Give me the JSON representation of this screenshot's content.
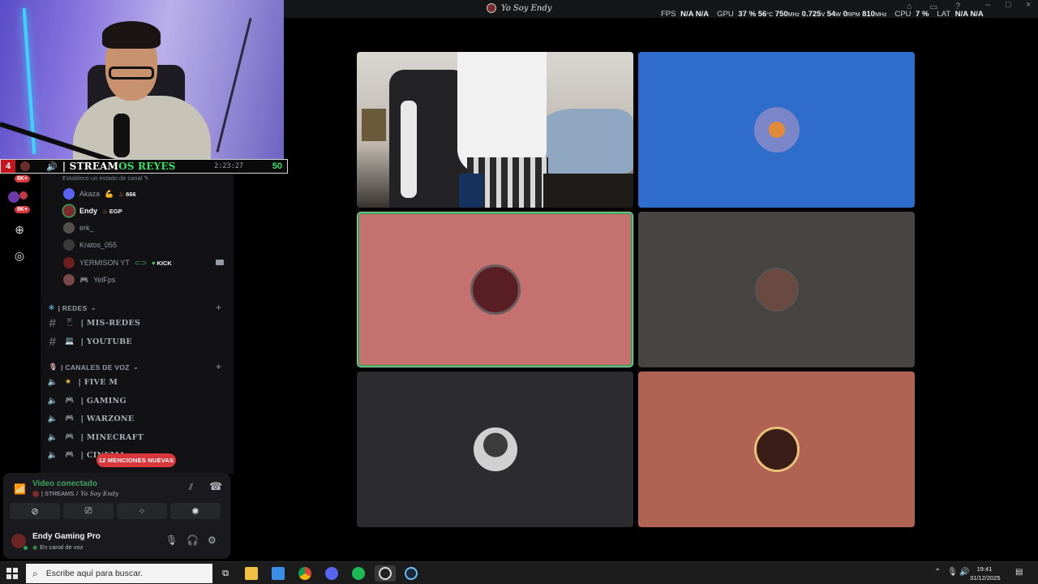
{
  "window": {
    "title": "Yo Soy Endy"
  },
  "perf": {
    "fps_label": "FPS",
    "fps_values": [
      "N/A",
      "N/A"
    ],
    "gpu_label": "GPU",
    "gpu_usage": "37 %",
    "gpu_temp": "56",
    "gpu_temp_unit": "°C",
    "gpu_clock": "750",
    "gpu_clock_unit": "MHz",
    "gpu_voltage": "0.725",
    "gpu_voltage_unit": "V",
    "gpu_power": "54",
    "gpu_power_unit": "W",
    "fan": "0",
    "fan_unit": "RPM",
    "mem_clock": "810",
    "mem_clock_unit": "MHz",
    "cpu_label": "CPU",
    "cpu_usage": "7 %",
    "lat_label": "LAT",
    "lat_values": [
      "N/A",
      "N/A"
    ]
  },
  "banner": {
    "count_left": "4",
    "title_prefix": "| STREAM",
    "title_suffix": "OS REYES",
    "time": "2:23:27",
    "count_right": "50"
  },
  "rail": {
    "badge_1": "8K+",
    "badge_2": "9K+",
    "add_icon": "plus-icon",
    "discover_icon": "compass-icon"
  },
  "channels": {
    "status_hint": "Establece un estado de canal",
    "members": [
      {
        "name": "Akaza",
        "emoji": "💪",
        "tag": "666",
        "tag_icon": "fire-icon",
        "color": "#5865f2"
      },
      {
        "name": "Endy",
        "tag": "EGP",
        "tag_icon": "fire-icon",
        "color": "#7a2b2b"
      },
      {
        "name": "erk_",
        "color": "#55504c"
      },
      {
        "name": "Kratos_055",
        "color": "#3a3a3a"
      },
      {
        "name": "YERMISON YT",
        "tag": "KICK",
        "tag_icon": "heart-icon",
        "color": "#6e1f1f"
      },
      {
        "name": "YelFps",
        "prefix": "🎮",
        "color": "#7a4a4a"
      }
    ],
    "categories": [
      {
        "label": "| REDES",
        "icon": "snowflake-icon"
      },
      {
        "label": "| CANALES DE VOZ",
        "icon": "mic-icon"
      }
    ],
    "text_channels": [
      {
        "label": "| MIS-REDES",
        "emoji": "📱"
      },
      {
        "label": "| YOUTUBE",
        "emoji": "💻"
      }
    ],
    "voice_channels": [
      {
        "label": "| FIVE M",
        "emoji": "★"
      },
      {
        "label": "| GAMING",
        "emoji": "🎮"
      },
      {
        "label": "| WARZONE",
        "emoji": "🎮"
      },
      {
        "label": "| MINECRAFT",
        "emoji": "🎮"
      },
      {
        "label": "| CINEMA",
        "emoji": "🎮"
      }
    ],
    "mentions_pill": "12 MENCIONES NUEVAS"
  },
  "voice": {
    "status": "Video conectado",
    "channel": "| STREAMS",
    "server": "Yo Soy Endy",
    "buttons": [
      "camera-off-icon",
      "screen-share-icon",
      "activities-icon",
      "soundboard-icon"
    ]
  },
  "user": {
    "name": "Endy Gaming Pro",
    "status": "En canal de voz"
  },
  "grid": {
    "tiles": [
      {
        "kind": "camera",
        "color": "#2c2b2e"
      },
      {
        "kind": "avatar",
        "color": "#2f6dcd",
        "avatar_color": "#7b86c9"
      },
      {
        "kind": "avatar",
        "color": "#c47170",
        "avatar_color": "#5a1f24",
        "speaking": true
      },
      {
        "kind": "avatar",
        "color": "#474442",
        "avatar_color": "#6a4a40"
      },
      {
        "kind": "avatar",
        "color": "#2c2c2e",
        "avatar_color": "#8a8a8a"
      },
      {
        "kind": "avatar",
        "color": "#b06253",
        "avatar_color": "#3b1d17"
      }
    ]
  },
  "taskbar": {
    "search_placeholder": "Escribe aquí para buscar.",
    "time": "19:41",
    "date": "31/12/2025"
  }
}
